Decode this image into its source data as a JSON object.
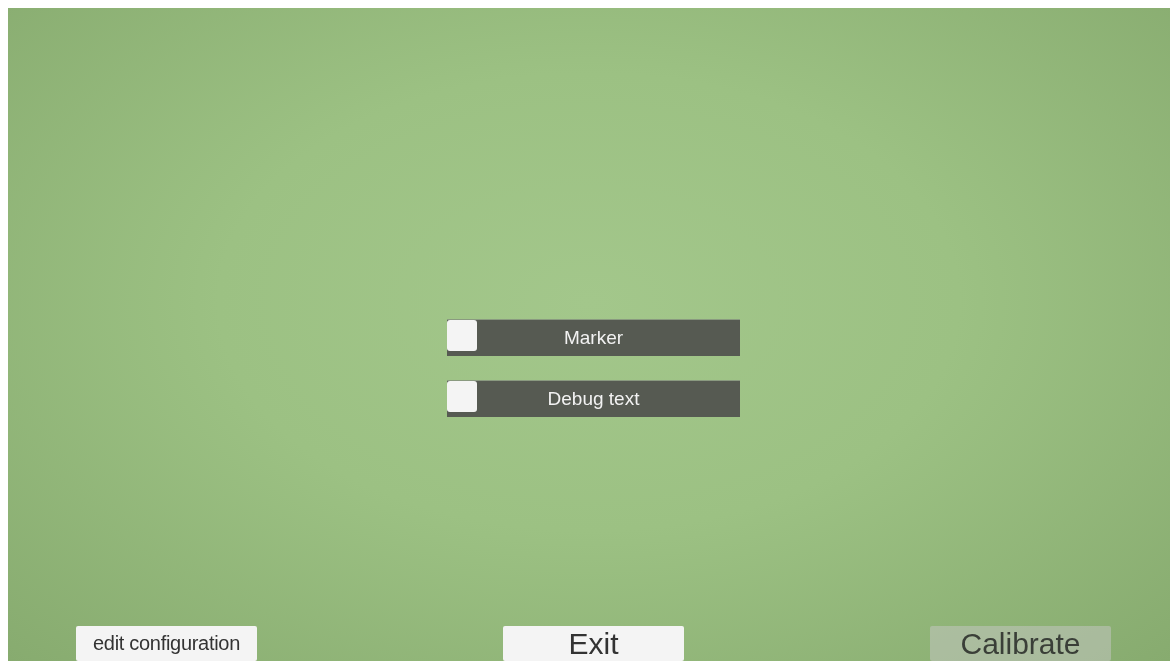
{
  "toggles": [
    {
      "label": "Marker",
      "checked": false
    },
    {
      "label": "Debug text",
      "checked": false
    }
  ],
  "buttons": [
    {
      "label": "edit configuration",
      "kind": "small",
      "disabled": false
    },
    {
      "label": "Exit",
      "kind": "large",
      "disabled": false
    },
    {
      "label": "Calibrate",
      "kind": "large",
      "disabled": true
    }
  ]
}
